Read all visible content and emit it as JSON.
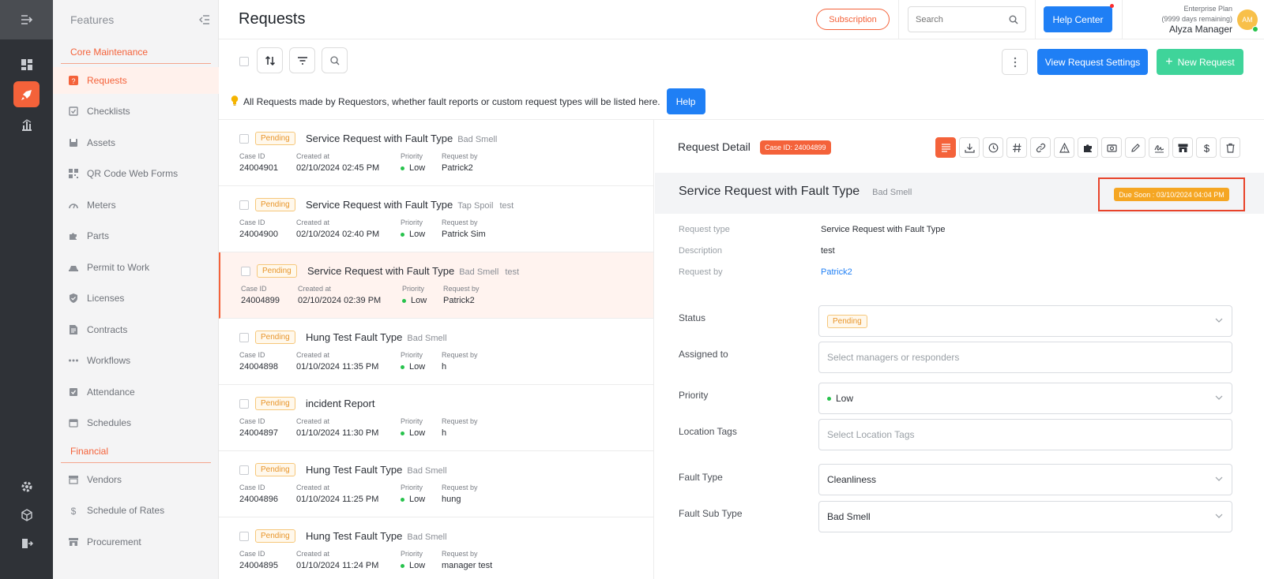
{
  "colors": {
    "accent": "#f4623a",
    "primary": "#1f7ff5",
    "success": "#3fd49a",
    "warning": "#f5a623",
    "highlight": "#e8432a"
  },
  "rail": {
    "items": [
      "dashboard-icon",
      "rocket-icon",
      "chart-icon",
      "gear-icon",
      "cube-icon",
      "logout-icon"
    ]
  },
  "features": {
    "title": "Features",
    "groups": [
      {
        "label": "Core Maintenance"
      },
      {
        "label": "Financial"
      }
    ],
    "items": [
      {
        "label": "Requests",
        "icon": "request-icon"
      },
      {
        "label": "Checklists",
        "icon": "checklist-icon"
      },
      {
        "label": "Assets",
        "icon": "asset-icon"
      },
      {
        "label": "QR Code Web Forms",
        "icon": "qr-icon"
      },
      {
        "label": "Meters",
        "icon": "meter-icon"
      },
      {
        "label": "Parts",
        "icon": "puzzle-icon"
      },
      {
        "label": "Permit to Work",
        "icon": "permit-icon"
      },
      {
        "label": "Licenses",
        "icon": "shield-icon"
      },
      {
        "label": "Contracts",
        "icon": "contract-icon"
      },
      {
        "label": "Workflows",
        "icon": "workflow-icon"
      },
      {
        "label": "Attendance",
        "icon": "attendance-icon"
      },
      {
        "label": "Schedules",
        "icon": "calendar-icon"
      },
      {
        "label": "Vendors",
        "icon": "store-icon"
      },
      {
        "label": "Schedule of Rates",
        "icon": "dollar-icon"
      },
      {
        "label": "Procurement",
        "icon": "procurement-icon"
      }
    ]
  },
  "header": {
    "title": "Requests",
    "subscription": "Subscription",
    "search_placeholder": "Search",
    "help_center": "Help Center",
    "plan": "Enterprise Plan",
    "plan_remaining": "(9999 days remaining)",
    "user": "Alyza Manager",
    "avatar": "AM"
  },
  "toolbar": {
    "view_settings": "View Request Settings",
    "new_request": "New Request",
    "new_request_icon": "+"
  },
  "banner": {
    "text": "All Requests made by Requestors, whether fault reports or custom request types will be listed here.",
    "help": "Help"
  },
  "list": {
    "labels": {
      "case_id": "Case ID",
      "created_at": "Created at",
      "priority": "Priority",
      "request_by": "Request by"
    },
    "items": [
      {
        "status": "Pending",
        "title": "Service Request with Fault Type",
        "sub": "Bad Smell",
        "sub2": "",
        "case_id": "24004901",
        "created": "02/10/2024 02:45 PM",
        "priority": "Low",
        "by": "Patrick2"
      },
      {
        "status": "Pending",
        "title": "Service Request with Fault Type",
        "sub": "Tap Spoil",
        "sub2": "test",
        "case_id": "24004900",
        "created": "02/10/2024 02:40 PM",
        "priority": "Low",
        "by": "Patrick Sim"
      },
      {
        "status": "Pending",
        "title": "Service Request with Fault Type",
        "sub": "Bad Smell",
        "sub2": "test",
        "case_id": "24004899",
        "created": "02/10/2024 02:39 PM",
        "priority": "Low",
        "by": "Patrick2"
      },
      {
        "status": "Pending",
        "title": "Hung Test Fault Type",
        "sub": "Bad Smell",
        "sub2": "",
        "case_id": "24004898",
        "created": "01/10/2024 11:35 PM",
        "priority": "Low",
        "by": "h"
      },
      {
        "status": "Pending",
        "title": "incident Report",
        "sub": "",
        "sub2": "",
        "case_id": "24004897",
        "created": "01/10/2024 11:30 PM",
        "priority": "Low",
        "by": "h"
      },
      {
        "status": "Pending",
        "title": "Hung Test Fault Type",
        "sub": "Bad Smell",
        "sub2": "",
        "case_id": "24004896",
        "created": "01/10/2024 11:25 PM",
        "priority": "Low",
        "by": "hung"
      },
      {
        "status": "Pending",
        "title": "Hung Test Fault Type",
        "sub": "Bad Smell",
        "sub2": "",
        "case_id": "24004895",
        "created": "01/10/2024 11:24 PM",
        "priority": "Low",
        "by": "manager test"
      }
    ]
  },
  "detail": {
    "title": "Request Detail",
    "case_id": "Case ID: 24004899",
    "band_title": "Service Request with Fault Type",
    "band_sub": "Bad Smell",
    "due": "Due Soon : 03/10/2024 04:04 PM",
    "info": [
      {
        "key": "Request type",
        "value": "Service Request with Fault Type"
      },
      {
        "key": "Description",
        "value": "test"
      },
      {
        "key": "Request by",
        "value": "Patrick2"
      }
    ],
    "fields": {
      "status_label": "Status",
      "status_value": "Pending",
      "assigned_label": "Assigned to",
      "assigned_placeholder": "Select managers or responders",
      "priority_label": "Priority",
      "priority_value": "Low",
      "location_label": "Location Tags",
      "location_placeholder": "Select Location Tags",
      "fault_label": "Fault Type",
      "fault_value": "Cleanliness",
      "subtype_label": "Fault Sub Type",
      "subtype_value": "Bad Smell"
    }
  }
}
